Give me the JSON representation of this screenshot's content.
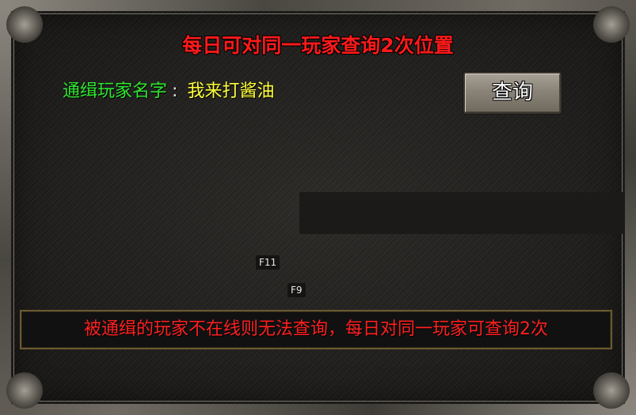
{
  "panel": {
    "title": "每日可对同一玩家查询2次位置",
    "wanted_label": "通缉玩家名字",
    "colon": ":",
    "player_name": "我来打酱油",
    "query_button": "查询",
    "hotkeys": [
      "F11",
      "F9"
    ],
    "notice": "被通缉的玩家不在线则无法查询，每日对同一玩家可查询2次"
  },
  "colors": {
    "title": "#ff1a1a",
    "label": "#2fe62f",
    "player_name": "#ffff3a",
    "notice": "#ff2020"
  }
}
